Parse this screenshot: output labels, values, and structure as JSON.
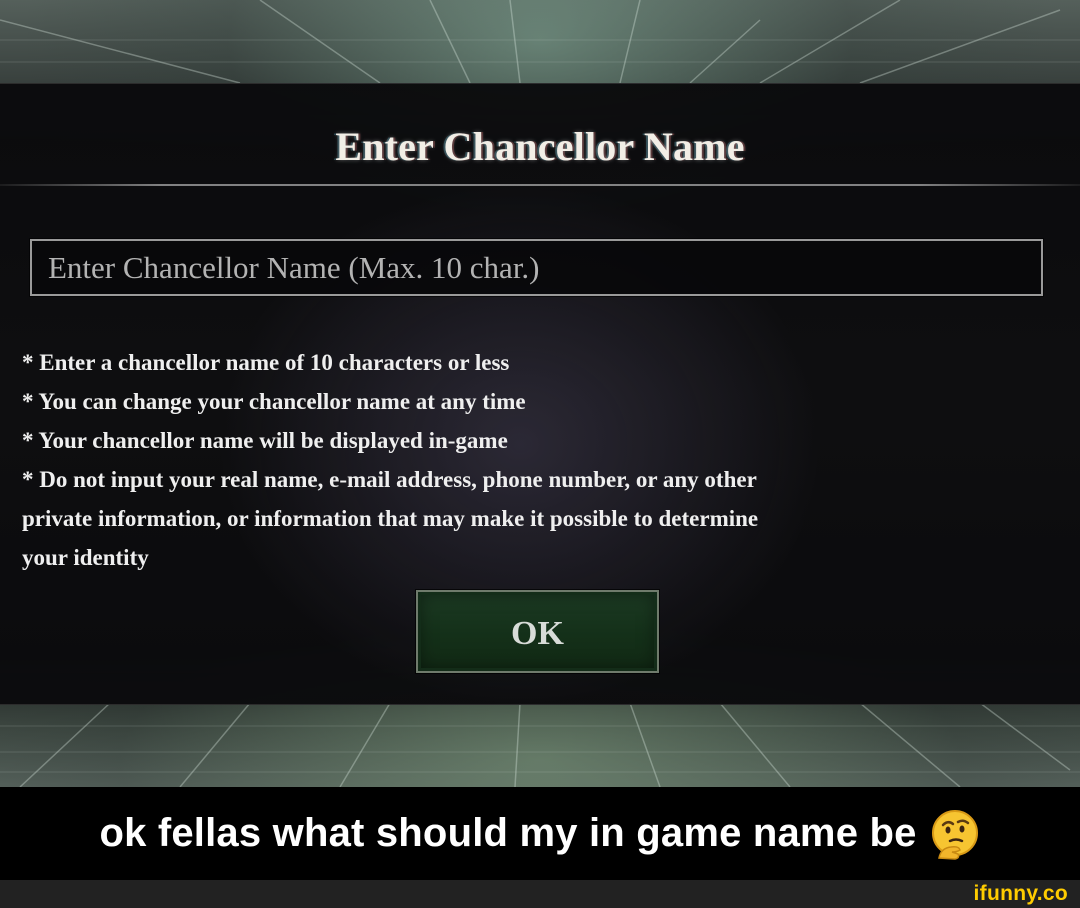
{
  "dialog": {
    "title": "Enter Chancellor Name",
    "input": {
      "placeholder": "Enter Chancellor Name (Max. 10 char.)",
      "value": ""
    },
    "notes": [
      "* Enter a chancellor name of 10 characters or less",
      "* You can change your chancellor name at any time",
      "* Your chancellor name will be displayed in-game",
      "* Do not input your real name, e-mail address, phone number, or any other",
      "private information, or information that may make it possible to determine",
      "your identity"
    ],
    "ok_label": "OK"
  },
  "caption": {
    "text": "ok fellas what should my in game name be",
    "emoji_icon": "thinking-face-icon"
  },
  "watermark": "ifunny.co",
  "colors": {
    "ok_button": "#153219",
    "watermark": "#ffcc00",
    "caption_bg": "#000000"
  }
}
